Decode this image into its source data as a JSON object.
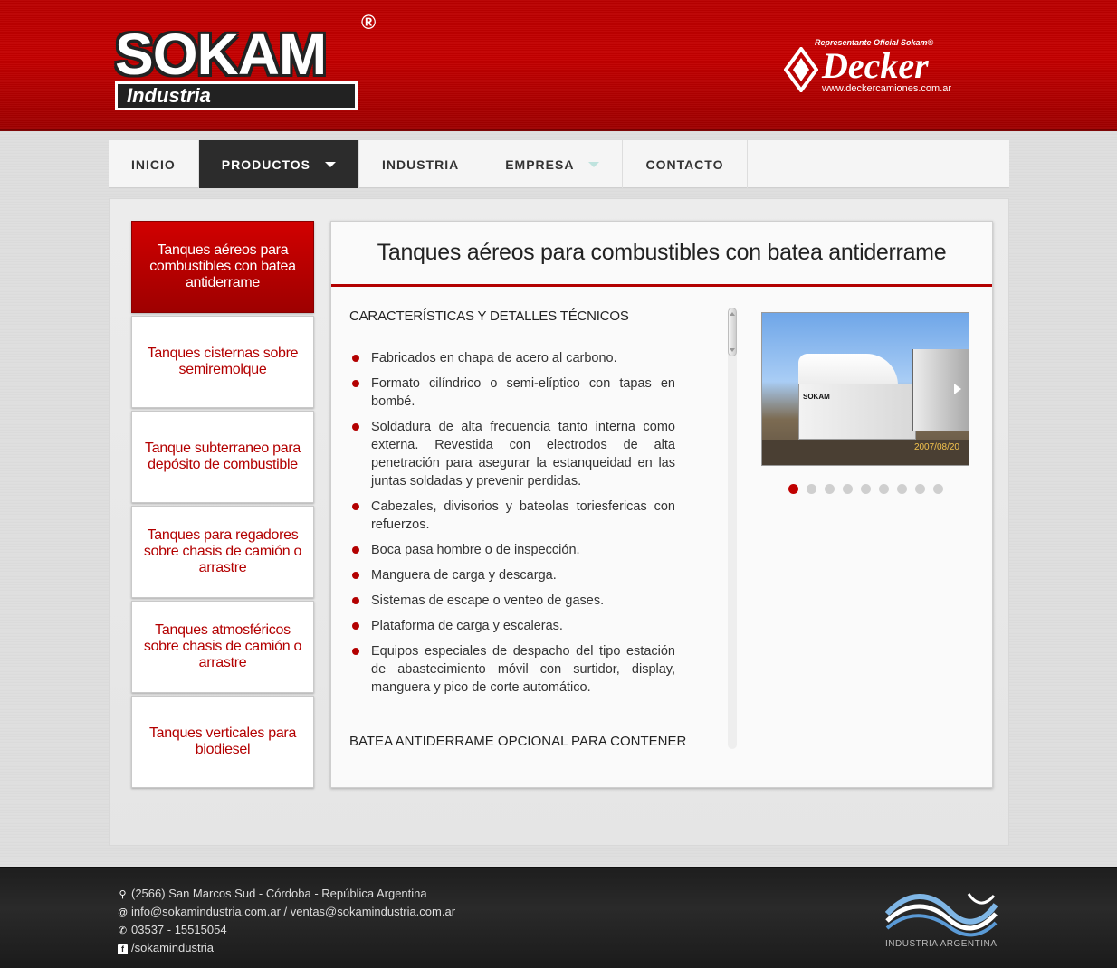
{
  "header": {
    "logo_word": "SOKAM",
    "logo_sub": "Industria",
    "logo_reg": "®",
    "decker_rep": "Representante Oficial Sokam®",
    "decker_name": "Decker",
    "decker_url": "www.deckercamiones.com.ar"
  },
  "nav": {
    "items": [
      {
        "label": "INICIO"
      },
      {
        "label": "PRODUCTOS"
      },
      {
        "label": "INDUSTRIA"
      },
      {
        "label": "EMPRESA"
      },
      {
        "label": "CONTACTO"
      }
    ]
  },
  "sidebar": {
    "items": [
      {
        "label": "Tanques aéreos para combustibles con batea antiderrame"
      },
      {
        "label": "Tanques cisternas sobre semiremolque"
      },
      {
        "label": "Tanque subterraneo para depósito de combustible"
      },
      {
        "label": "Tanques para regadores sobre chasis de camión o arrastre"
      },
      {
        "label": "Tanques atmosféricos sobre chasis de camión o arrastre"
      },
      {
        "label": "Tanques verticales para biodiesel"
      }
    ]
  },
  "main": {
    "title": "Tanques aéreos para combustibles con batea antiderrame",
    "section_heading": "CARACTERÍSTICAS Y DETALLES TÉCNICOS",
    "bullets": [
      "Fabricados en chapa de acero al carbono.",
      "Formato cilíndrico o semi-elíptico con tapas en bombé.",
      "Soldadura de alta frecuencia tanto interna como externa. Revestida con electrodos de alta penetración para asegurar la estanqueidad en las juntas soldadas y prevenir perdidas.",
      "Cabezales, divisorios y bateolas toriesfericas con refuerzos.",
      "Boca pasa hombre o de inspección.",
      "Manguera de carga y descarga.",
      "Sistemas de escape o venteo de gases.",
      "Plataforma de carga y escaleras.",
      "Equipos especiales de despacho del tipo estación de abastecimiento móvil con surtidor, display, manguera y pico de corte automático."
    ],
    "section_heading_2": "BATEA ANTIDERRAME OPCIONAL PARA CONTENER",
    "photo_date": "2007/08/20",
    "photo_brand": "SOKAM"
  },
  "footer": {
    "address": "(2566) San Marcos Sud - Córdoba - República Argentina",
    "email": "info@sokamindustria.com.ar / ventas@sokamindustria.com.ar",
    "phone": "03537 - 15515054",
    "facebook": "/sokamindustria",
    "badge": "INDUSTRIA ARGENTINA"
  },
  "colors": {
    "brand_red": "#b90000",
    "nav_active": "#2c2c2c"
  }
}
